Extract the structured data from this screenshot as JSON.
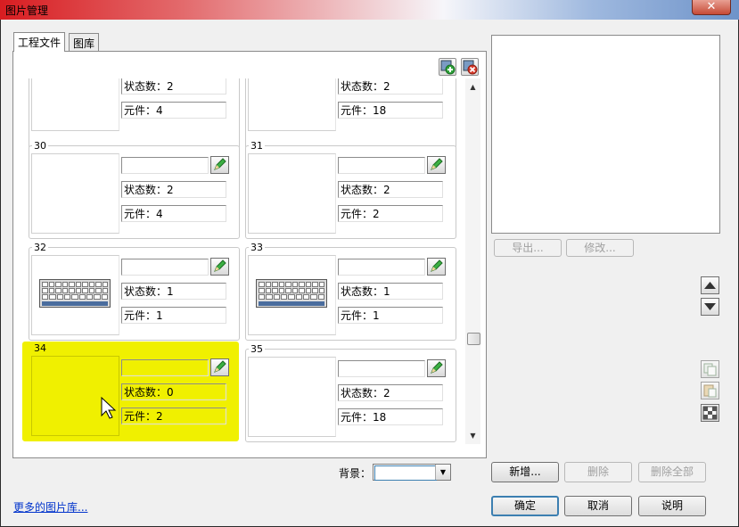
{
  "window": {
    "title": "图片管理",
    "close_label": "✕"
  },
  "tabs": [
    {
      "label": "工程文件"
    },
    {
      "label": "图库"
    }
  ],
  "list": {
    "items": [
      {
        "id": "top-left",
        "number": "",
        "state_text": "状态数：2",
        "component_text": "元件：4",
        "has_thumb": false,
        "selected": false
      },
      {
        "id": "top-right",
        "number": "",
        "state_text": "状态数：2",
        "component_text": "元件：18",
        "has_thumb": false,
        "selected": false
      },
      {
        "id": "30",
        "number": "30",
        "state_text": "状态数：2",
        "component_text": "元件：4",
        "has_thumb": false,
        "selected": false
      },
      {
        "id": "31",
        "number": "31",
        "state_text": "状态数：2",
        "component_text": "元件：2",
        "has_thumb": false,
        "selected": false
      },
      {
        "id": "32",
        "number": "32",
        "state_text": "状态数：1",
        "component_text": "元件：1",
        "has_thumb": true,
        "selected": false
      },
      {
        "id": "33",
        "number": "33",
        "state_text": "状态数：1",
        "component_text": "元件：1",
        "has_thumb": true,
        "selected": false
      },
      {
        "id": "34",
        "number": "34",
        "state_text": "状态数：0",
        "component_text": "元件：2",
        "has_thumb": false,
        "selected": true
      },
      {
        "id": "35",
        "number": "35",
        "state_text": "状态数：2",
        "component_text": "元件：18",
        "has_thumb": false,
        "selected": false
      }
    ],
    "highlight_color": "#f0f000"
  },
  "preview_buttons": {
    "export": "导出...",
    "modify": "修改..."
  },
  "background": {
    "label": "背景："
  },
  "actions": {
    "add": "新增...",
    "delete": "删除",
    "delete_all": "删除全部"
  },
  "dialog_buttons": {
    "ok": "确定",
    "cancel": "取消",
    "help": "说明"
  },
  "more_link": "更多的图片库..."
}
